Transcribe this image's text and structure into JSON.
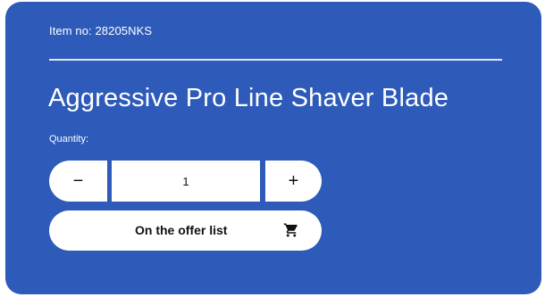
{
  "product": {
    "item_no": "Item no: 28205NKS",
    "title": "Aggressive Pro Line Shaver Blade"
  },
  "quantity": {
    "label": "Quantity:",
    "value": "1",
    "decrement_label": "−",
    "increment_label": "+"
  },
  "actions": {
    "offer_list_label": "On the offer list",
    "offer_list_icon": "cart-icon"
  },
  "colors": {
    "card_background": "#2e5bb9",
    "button_background": "#ffffff",
    "text_on_card": "#ffffff",
    "text_on_button": "#111111"
  }
}
